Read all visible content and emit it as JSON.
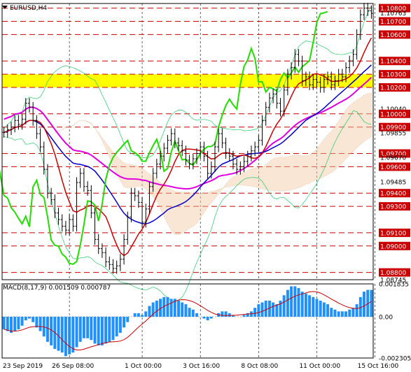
{
  "symbol": "EURUSD,H4",
  "macd_label": "MACD(8,17,9) 0.001509 0.000787",
  "price_axis": [
    {
      "text": "1.10800",
      "price": 1.108,
      "box": true
    },
    {
      "text": "1.10763",
      "price": 1.10763,
      "box": false,
      "current": true
    },
    {
      "text": "1.10700",
      "price": 1.107,
      "box": true
    },
    {
      "text": "1.10600",
      "price": 1.106,
      "box": true
    },
    {
      "text": "1.10400",
      "price": 1.104,
      "box": true
    },
    {
      "text": "1.10300",
      "price": 1.103,
      "box": true
    },
    {
      "text": "1.10200",
      "price": 1.102,
      "box": true
    },
    {
      "text": "1.10040",
      "price": 1.1004,
      "box": false
    },
    {
      "text": "1.10000",
      "price": 1.1,
      "box": true
    },
    {
      "text": "1.09900",
      "price": 1.099,
      "box": true
    },
    {
      "text": "1.09855",
      "price": 1.09855,
      "box": false
    },
    {
      "text": "1.09700",
      "price": 1.097,
      "box": true
    },
    {
      "text": "1.09670",
      "price": 1.0967,
      "box": false
    },
    {
      "text": "1.09600",
      "price": 1.096,
      "box": true
    },
    {
      "text": "1.09485",
      "price": 1.09485,
      "box": false
    },
    {
      "text": "1.09400",
      "price": 1.094,
      "box": true
    },
    {
      "text": "1.09300",
      "price": 1.093,
      "box": true
    },
    {
      "text": "1.09100",
      "price": 1.091,
      "box": true
    },
    {
      "text": "1.09000",
      "price": 1.09,
      "box": true
    },
    {
      "text": "1.08800",
      "price": 1.088,
      "box": true
    },
    {
      "text": "1.08745",
      "price": 1.08745,
      "box": false
    }
  ],
  "macd_axis": [
    {
      "text": "0.001835",
      "value": 0.001835
    },
    {
      "text": "0.00",
      "value": 0
    },
    {
      "text": "-0.002305",
      "value": -0.002305
    }
  ],
  "time_labels": [
    {
      "text": "23 Sep 2019",
      "bar": 0
    },
    {
      "text": "26 Sep 08:00",
      "bar": 18
    },
    {
      "text": "1 Oct 00:00",
      "bar": 38
    },
    {
      "text": "3 Oct 16:00",
      "bar": 54
    },
    {
      "text": "8 Oct 08:00",
      "bar": 70
    },
    {
      "text": "11 Oct 00:00",
      "bar": 86
    },
    {
      "text": "15 Oct 16:00",
      "bar": 102
    }
  ],
  "colors": {
    "level_line": "#cc0000",
    "label_box": "#cc0000",
    "yellow_zone": "#ffff00",
    "magenta": "#e000e0",
    "green": "#22dd00",
    "blue": "#0000cc",
    "red": "#cc0000",
    "macd_hist": "#1e90ff",
    "macd_signal": "#cc0000",
    "grid": "#000000",
    "bollinger": "#22cc66"
  },
  "chart_data": {
    "type": "candlestick",
    "title": "EURUSD,H4",
    "ylim": [
      1.08745,
      1.10835
    ],
    "levels": [
      1.108,
      1.107,
      1.106,
      1.104,
      1.103,
      1.102,
      1.1,
      1.099,
      1.097,
      1.096,
      1.094,
      1.093,
      1.091,
      1.09,
      1.088
    ],
    "highlight_zone": [
      1.102,
      1.103
    ],
    "close": [
      1.0986,
      1.0988,
      1.099,
      1.0995,
      1.0992,
      1.0996,
      1.1008,
      1.1005,
      1.0995,
      1.0985,
      1.0975,
      1.0958,
      1.094,
      1.0935,
      1.0925,
      1.092,
      1.0915,
      1.0912,
      1.092,
      1.0915,
      1.0948,
      1.0955,
      1.0945,
      1.0942,
      1.0925,
      1.0905,
      1.0898,
      1.0895,
      1.0888,
      1.0886,
      1.0883,
      1.0885,
      1.089,
      1.0905,
      1.0922,
      1.094,
      1.0938,
      1.0933,
      1.0918,
      1.0928,
      1.0945,
      1.0955,
      1.0962,
      1.0968,
      1.0974,
      1.098,
      1.0985,
      1.0978,
      1.0976,
      1.0972,
      1.0965,
      1.0962,
      1.0966,
      1.097,
      1.0975,
      1.0968,
      1.0955,
      1.096,
      1.0975,
      1.0985,
      1.0978,
      1.097,
      1.0968,
      1.0962,
      1.0958,
      1.096,
      1.0964,
      1.0968,
      1.0972,
      1.0975,
      1.098,
      1.0995,
      1.1005,
      1.1012,
      1.1015,
      1.1008,
      1.1002,
      1.1018,
      1.103,
      1.1035,
      1.1045,
      1.104,
      1.1025,
      1.1028,
      1.1022,
      1.1026,
      1.1024,
      1.102,
      1.1026,
      1.1028,
      1.1022,
      1.1025,
      1.103,
      1.1028,
      1.1035,
      1.104,
      1.1045,
      1.106,
      1.1075,
      1.108,
      1.1078,
      1.1076
    ],
    "macd": [
      -0.0007,
      -0.0008,
      -0.0009,
      -0.0008,
      -0.0007,
      -0.0005,
      -0.0002,
      -0.0001,
      -0.0003,
      -0.0006,
      -0.0008,
      -0.0011,
      -0.0014,
      -0.0016,
      -0.0018,
      -0.0019,
      -0.002,
      -0.0022,
      -0.0021,
      -0.002,
      -0.0017,
      -0.0014,
      -0.0012,
      -0.0012,
      -0.0013,
      -0.0015,
      -0.0016,
      -0.0016,
      -0.0015,
      -0.0014,
      -0.0013,
      -0.0011,
      -0.0009,
      -0.0006,
      -0.0003,
      0.0,
      0.0002,
      0.0002,
      0.0001,
      0.0003,
      0.0006,
      0.0008,
      0.0009,
      0.001,
      0.0011,
      0.0011,
      0.001,
      0.001,
      0.0009,
      0.0008,
      0.0007,
      0.0005,
      0.0004,
      0.0002,
      0.0,
      -0.0001,
      -0.0002,
      -0.0001,
      0.0,
      0.0002,
      0.0003,
      0.0003,
      0.0002,
      0.0001,
      0.0,
      0.0,
      0.0001,
      0.0002,
      0.0003,
      0.0005,
      0.0007,
      0.0008,
      0.0009,
      0.0009,
      0.0008,
      0.0007,
      0.0009,
      0.0012,
      0.0015,
      0.0017,
      0.0017,
      0.0016,
      0.0014,
      0.0013,
      0.0012,
      0.0011,
      0.001,
      0.0009,
      0.0008,
      0.0007,
      0.0005,
      0.0004,
      0.0003,
      0.0003,
      0.0003,
      0.0004,
      0.0005,
      0.0007,
      0.0011,
      0.0014,
      0.0015,
      0.0015
    ]
  }
}
